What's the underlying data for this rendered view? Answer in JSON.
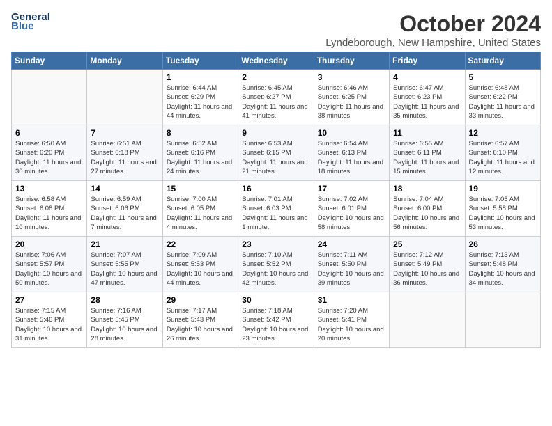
{
  "logo": {
    "line1": "General",
    "line2": "Blue"
  },
  "title": "October 2024",
  "location": "Lyndeborough, New Hampshire, United States",
  "days_of_week": [
    "Sunday",
    "Monday",
    "Tuesday",
    "Wednesday",
    "Thursday",
    "Friday",
    "Saturday"
  ],
  "weeks": [
    [
      {
        "day": "",
        "info": ""
      },
      {
        "day": "",
        "info": ""
      },
      {
        "day": "1",
        "info": "Sunrise: 6:44 AM\nSunset: 6:29 PM\nDaylight: 11 hours and 44 minutes."
      },
      {
        "day": "2",
        "info": "Sunrise: 6:45 AM\nSunset: 6:27 PM\nDaylight: 11 hours and 41 minutes."
      },
      {
        "day": "3",
        "info": "Sunrise: 6:46 AM\nSunset: 6:25 PM\nDaylight: 11 hours and 38 minutes."
      },
      {
        "day": "4",
        "info": "Sunrise: 6:47 AM\nSunset: 6:23 PM\nDaylight: 11 hours and 35 minutes."
      },
      {
        "day": "5",
        "info": "Sunrise: 6:48 AM\nSunset: 6:22 PM\nDaylight: 11 hours and 33 minutes."
      }
    ],
    [
      {
        "day": "6",
        "info": "Sunrise: 6:50 AM\nSunset: 6:20 PM\nDaylight: 11 hours and 30 minutes."
      },
      {
        "day": "7",
        "info": "Sunrise: 6:51 AM\nSunset: 6:18 PM\nDaylight: 11 hours and 27 minutes."
      },
      {
        "day": "8",
        "info": "Sunrise: 6:52 AM\nSunset: 6:16 PM\nDaylight: 11 hours and 24 minutes."
      },
      {
        "day": "9",
        "info": "Sunrise: 6:53 AM\nSunset: 6:15 PM\nDaylight: 11 hours and 21 minutes."
      },
      {
        "day": "10",
        "info": "Sunrise: 6:54 AM\nSunset: 6:13 PM\nDaylight: 11 hours and 18 minutes."
      },
      {
        "day": "11",
        "info": "Sunrise: 6:55 AM\nSunset: 6:11 PM\nDaylight: 11 hours and 15 minutes."
      },
      {
        "day": "12",
        "info": "Sunrise: 6:57 AM\nSunset: 6:10 PM\nDaylight: 11 hours and 12 minutes."
      }
    ],
    [
      {
        "day": "13",
        "info": "Sunrise: 6:58 AM\nSunset: 6:08 PM\nDaylight: 11 hours and 10 minutes."
      },
      {
        "day": "14",
        "info": "Sunrise: 6:59 AM\nSunset: 6:06 PM\nDaylight: 11 hours and 7 minutes."
      },
      {
        "day": "15",
        "info": "Sunrise: 7:00 AM\nSunset: 6:05 PM\nDaylight: 11 hours and 4 minutes."
      },
      {
        "day": "16",
        "info": "Sunrise: 7:01 AM\nSunset: 6:03 PM\nDaylight: 11 hours and 1 minute."
      },
      {
        "day": "17",
        "info": "Sunrise: 7:02 AM\nSunset: 6:01 PM\nDaylight: 10 hours and 58 minutes."
      },
      {
        "day": "18",
        "info": "Sunrise: 7:04 AM\nSunset: 6:00 PM\nDaylight: 10 hours and 56 minutes."
      },
      {
        "day": "19",
        "info": "Sunrise: 7:05 AM\nSunset: 5:58 PM\nDaylight: 10 hours and 53 minutes."
      }
    ],
    [
      {
        "day": "20",
        "info": "Sunrise: 7:06 AM\nSunset: 5:57 PM\nDaylight: 10 hours and 50 minutes."
      },
      {
        "day": "21",
        "info": "Sunrise: 7:07 AM\nSunset: 5:55 PM\nDaylight: 10 hours and 47 minutes."
      },
      {
        "day": "22",
        "info": "Sunrise: 7:09 AM\nSunset: 5:53 PM\nDaylight: 10 hours and 44 minutes."
      },
      {
        "day": "23",
        "info": "Sunrise: 7:10 AM\nSunset: 5:52 PM\nDaylight: 10 hours and 42 minutes."
      },
      {
        "day": "24",
        "info": "Sunrise: 7:11 AM\nSunset: 5:50 PM\nDaylight: 10 hours and 39 minutes."
      },
      {
        "day": "25",
        "info": "Sunrise: 7:12 AM\nSunset: 5:49 PM\nDaylight: 10 hours and 36 minutes."
      },
      {
        "day": "26",
        "info": "Sunrise: 7:13 AM\nSunset: 5:48 PM\nDaylight: 10 hours and 34 minutes."
      }
    ],
    [
      {
        "day": "27",
        "info": "Sunrise: 7:15 AM\nSunset: 5:46 PM\nDaylight: 10 hours and 31 minutes."
      },
      {
        "day": "28",
        "info": "Sunrise: 7:16 AM\nSunset: 5:45 PM\nDaylight: 10 hours and 28 minutes."
      },
      {
        "day": "29",
        "info": "Sunrise: 7:17 AM\nSunset: 5:43 PM\nDaylight: 10 hours and 26 minutes."
      },
      {
        "day": "30",
        "info": "Sunrise: 7:18 AM\nSunset: 5:42 PM\nDaylight: 10 hours and 23 minutes."
      },
      {
        "day": "31",
        "info": "Sunrise: 7:20 AM\nSunset: 5:41 PM\nDaylight: 10 hours and 20 minutes."
      },
      {
        "day": "",
        "info": ""
      },
      {
        "day": "",
        "info": ""
      }
    ]
  ]
}
